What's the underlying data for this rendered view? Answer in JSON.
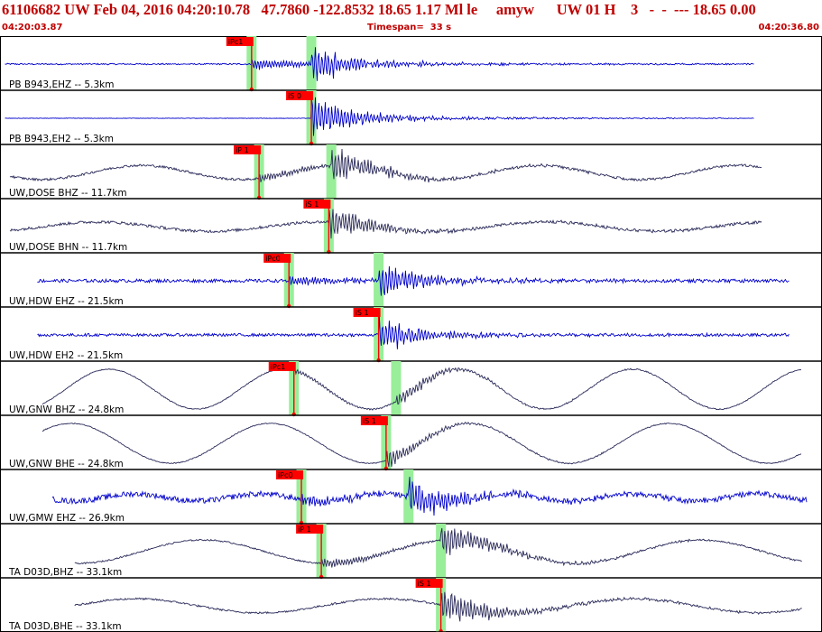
{
  "header": {
    "title": "61106682 UW Feb 04, 2016 04:20:10.78   47.7860 -122.8532 18.65 1.17 Ml le     amyw      UW 01 H    3   -  -  --- 18.65 0.00",
    "start_time": "04:20:03.87",
    "timespan": "Timespan=  33 s",
    "end_time": "04:20:36.80"
  },
  "colors": {
    "header_text": "#c00000",
    "blue_trace": "#0000cc",
    "dark_trace": "#2a2a5a",
    "pick_flag": "#ff0000",
    "pick_window": "#99ee99"
  },
  "chart_data": {
    "type": "line",
    "x_range_seconds": [
      0,
      33
    ],
    "traces": [
      {
        "label": "PB B943,EHZ -- 5.3km",
        "color": "blue",
        "start": 0.2,
        "end": 30.3,
        "phase": "iPc1",
        "pick": 10.1,
        "arrival": 12.5,
        "noise": 0.03,
        "amp": 0.9,
        "lowfreq": 0,
        "period": 0
      },
      {
        "label": "PB B943,EH2 -- 5.3km",
        "color": "blue",
        "start": 0.2,
        "end": 30.3,
        "phase": "iS 0",
        "pick": 12.5,
        "arrival": 12.5,
        "noise": 0.01,
        "amp": 1.1,
        "lowfreq": 0,
        "period": 0
      },
      {
        "label": "UW,DOSE BHZ -- 11.7km",
        "color": "dark",
        "start": 0.4,
        "end": 30.6,
        "phase": "iP 1",
        "pick": 10.4,
        "arrival": 13.3,
        "noise": 0.05,
        "amp": 0.8,
        "lowfreq": 0.3,
        "period": 8
      },
      {
        "label": "UW,DOSE BHN -- 11.7km",
        "color": "dark",
        "start": 0.4,
        "end": 30.6,
        "phase": "iS 1",
        "pick": 13.2,
        "arrival": 13.2,
        "noise": 0.06,
        "amp": 0.8,
        "lowfreq": 0.2,
        "period": 9
      },
      {
        "label": "UW,HDW EHZ -- 21.5km",
        "color": "blue",
        "start": 1.5,
        "end": 31.7,
        "phase": "iPc0",
        "pick": 11.6,
        "arrival": 15.2,
        "noise": 0.07,
        "amp": 0.9,
        "lowfreq": 0,
        "period": 0
      },
      {
        "label": "UW,HDW EH2 -- 21.5km",
        "color": "blue",
        "start": 1.5,
        "end": 31.7,
        "phase": "iS 1",
        "pick": 15.2,
        "arrival": 15.2,
        "noise": 0.06,
        "amp": 0.9,
        "lowfreq": 0,
        "period": 0
      },
      {
        "label": "UW,GNW BHZ -- 24.8km",
        "color": "dark",
        "start": 1.7,
        "end": 32.2,
        "phase": "iPc1",
        "pick": 11.8,
        "arrival": 15.9,
        "noise": 0.02,
        "amp": 0.4,
        "lowfreq": 0.85,
        "period": 7
      },
      {
        "label": "UW,GNW BHE -- 24.8km",
        "color": "dark",
        "start": 1.7,
        "end": 32.2,
        "phase": "iS 1",
        "pick": 15.5,
        "arrival": 15.5,
        "noise": 0.02,
        "amp": 0.4,
        "lowfreq": 0.85,
        "period": 8
      },
      {
        "label": "UW,GMW EHZ -- 26.9km",
        "color": "blue",
        "start": 2.1,
        "end": 32.4,
        "phase": "iPc0",
        "pick": 12.1,
        "arrival": 16.4,
        "noise": 0.12,
        "amp": 0.9,
        "lowfreq": 0.15,
        "period": 5
      },
      {
        "label": "TA D03D,BHZ -- 33.1km",
        "color": "dark",
        "start": 3.0,
        "end": 32.2,
        "phase": "iP 1",
        "pick": 12.9,
        "arrival": 17.7,
        "noise": 0.03,
        "amp": 0.9,
        "lowfreq": 0.5,
        "period": 10
      },
      {
        "label": "TA D03D,BHE -- 33.1km",
        "color": "dark",
        "start": 3.0,
        "end": 32.2,
        "phase": "iS 1",
        "pick": 17.7,
        "arrival": 17.7,
        "noise": 0.04,
        "amp": 1.0,
        "lowfreq": 0.3,
        "period": 10
      }
    ]
  }
}
